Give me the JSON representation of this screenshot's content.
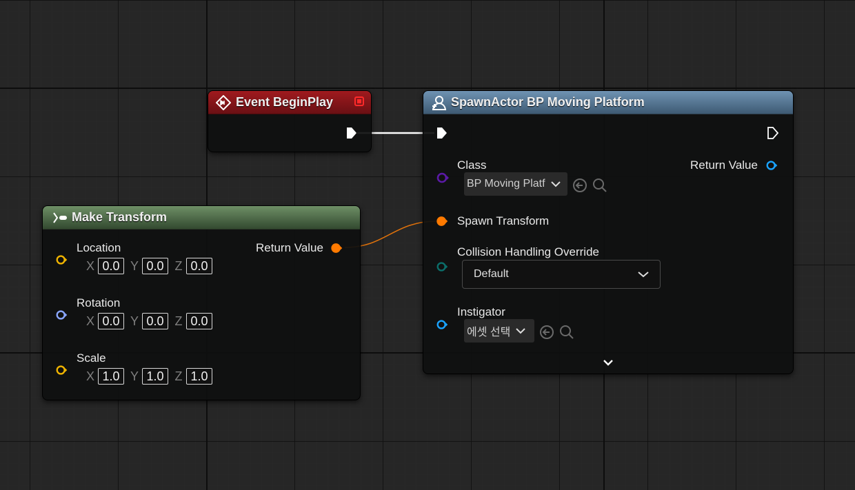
{
  "colors": {
    "exec": "#ffffff",
    "class_pin": "#5b1aa6",
    "transform_pin": "#ff7a00",
    "vector_pin": "#f0b400",
    "rotator_pin": "#8aa6ff",
    "enum_pin": "#0b6e6a",
    "object_pin": "#1aa3ff",
    "event_header": "#7a1216",
    "make_transform_header": "#4a6b45",
    "spawn_header": "#4e6f8a"
  },
  "event_begin_play": {
    "title": "Event BeginPlay",
    "icon": "event-diamond-icon",
    "badge_icon": "delegate-square-icon"
  },
  "spawn_actor": {
    "title": "SpawnActor BP Moving Platform",
    "icon": "spawn-actor-icon",
    "class_label": "Class",
    "class_value": "BP Moving Platf",
    "return_label": "Return Value",
    "spawn_transform_label": "Spawn Transform",
    "collision_label": "Collision Handling Override",
    "collision_value": "Default",
    "instigator_label": "Instigator",
    "instigator_value": "에셋 선택",
    "expand_icon": "chevron-down-icon"
  },
  "make_transform": {
    "title": "Make Transform",
    "icon": "function-icon",
    "return_label": "Return Value",
    "inputs": [
      {
        "label": "Location",
        "x": "0.0",
        "y": "0.0",
        "z": "0.0"
      },
      {
        "label": "Rotation",
        "x": "0.0",
        "y": "0.0",
        "z": "0.0"
      },
      {
        "label": "Scale",
        "x": "1.0",
        "y": "1.0",
        "z": "1.0"
      }
    ],
    "axis_labels": {
      "x": "X",
      "y": "Y",
      "z": "Z"
    }
  }
}
